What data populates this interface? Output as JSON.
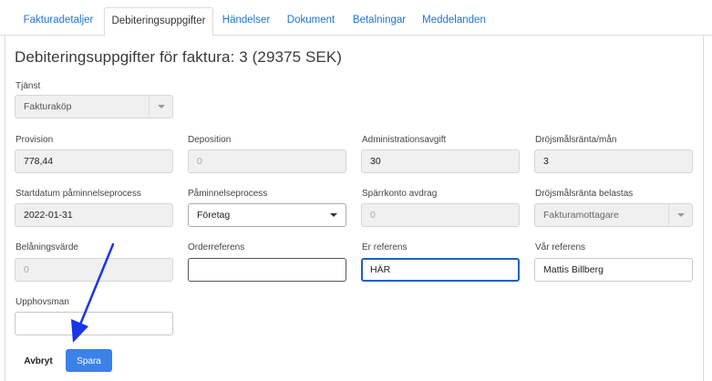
{
  "tabs": [
    {
      "label": "Fakturadetaljer",
      "active": false
    },
    {
      "label": "Debiteringsuppgifter",
      "active": true
    },
    {
      "label": "Händelser",
      "active": false
    },
    {
      "label": "Dokument",
      "active": false
    },
    {
      "label": "Betalningar",
      "active": false
    },
    {
      "label": "Meddelanden",
      "active": false
    }
  ],
  "title": "Debiteringsuppgifter för faktura: 3 (29375 SEK)",
  "form": {
    "tjanst": {
      "label": "Tjänst",
      "value": "Fakturaköp"
    },
    "provision": {
      "label": "Provision",
      "value": "778,44"
    },
    "deposition": {
      "label": "Deposition",
      "placeholder": "0"
    },
    "administrationsavgift": {
      "label": "Administrationsavgift",
      "value": "30"
    },
    "drojsmalsranta": {
      "label": "Dröjsmålsränta/mån",
      "value": "3"
    },
    "startdatum": {
      "label": "Startdatum påminnelseprocess",
      "value": "2022-01-31"
    },
    "paminnelseprocess": {
      "label": "Påminnelseprocess",
      "value": "Företag"
    },
    "sparrkonto": {
      "label": "Spärrkonto avdrag",
      "placeholder": "0"
    },
    "drojsmal_belastas": {
      "label": "Dröjsmålsränta belastas",
      "value": "Fakturamottagare"
    },
    "belaningsvarde": {
      "label": "Belåningsvärde",
      "placeholder": "0"
    },
    "orderreferens": {
      "label": "Orderreferens",
      "value": ""
    },
    "er_referens": {
      "label": "Er referens",
      "value": "HÄR"
    },
    "var_referens": {
      "label": "Vår referens",
      "value": "Mattis Billberg"
    },
    "upphovsman": {
      "label": "Upphovsman",
      "value": ""
    }
  },
  "actions": {
    "cancel_label": "Avbryt",
    "save_label": "Spara"
  },
  "colors": {
    "link": "#1e73d8",
    "primary_button": "#3b82e8",
    "annotation_arrow": "#1a35e8"
  }
}
